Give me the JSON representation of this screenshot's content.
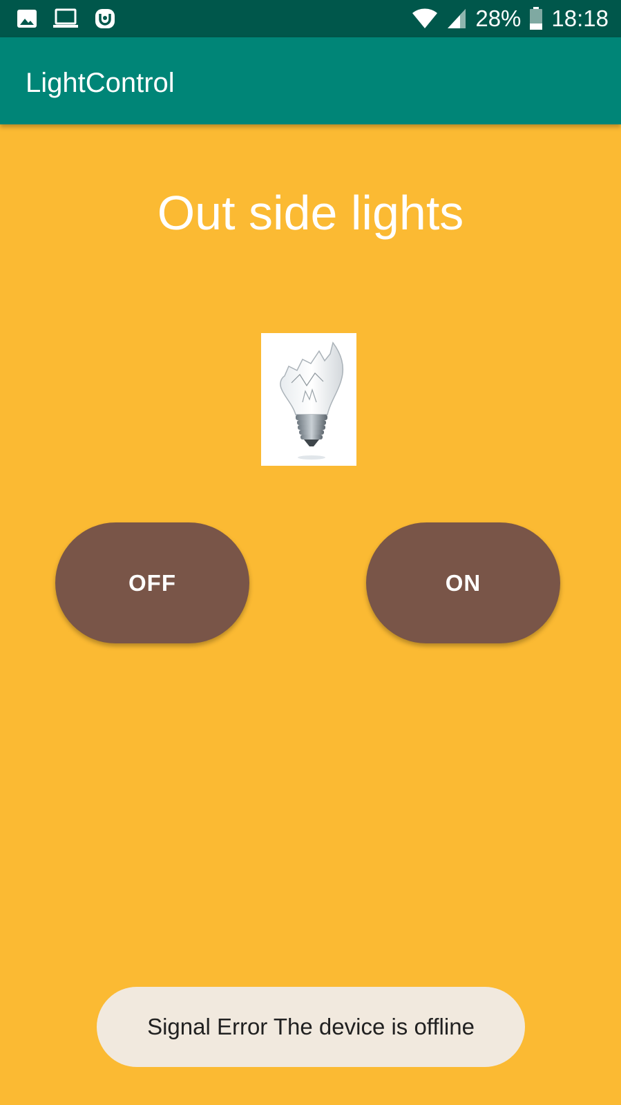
{
  "status_bar": {
    "icons_left": [
      "gallery-icon",
      "laptop-icon",
      "app-notification-icon"
    ],
    "battery_percent": "28%",
    "time": "18:18",
    "icons_right": [
      "wifi-icon",
      "cell-signal-icon",
      "battery-icon"
    ]
  },
  "app_bar": {
    "title": "LightControl"
  },
  "main": {
    "heading": "Out side lights",
    "image_icon": "broken-bulb-icon",
    "off_label": "OFF",
    "on_label": "ON"
  },
  "toast": {
    "message": "Signal Error The device is offline"
  },
  "colors": {
    "status_bar": "#00574B",
    "app_bar": "#008577",
    "background": "#FBBA33",
    "button": "#795548",
    "toast": "#F1E9DE"
  }
}
